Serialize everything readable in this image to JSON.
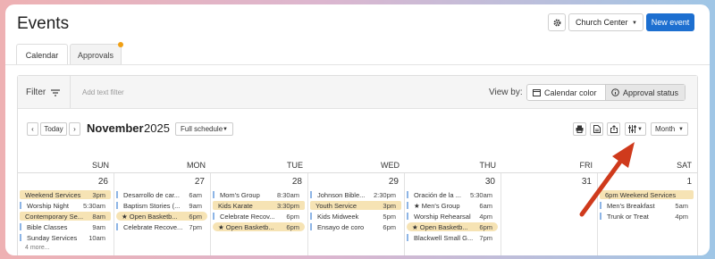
{
  "header": {
    "title": "Events",
    "org_select": "Church Center",
    "new_event_label": "New event"
  },
  "tabs": [
    {
      "label": "Calendar"
    },
    {
      "label": "Approvals"
    }
  ],
  "filter_bar": {
    "filter_label": "Filter",
    "add_filter_placeholder": "Add text filter",
    "view_by_label": "View by:",
    "options": [
      "Calendar color",
      "Approval status"
    ]
  },
  "toolbar": {
    "today_label": "Today",
    "month": "November",
    "year": "2025",
    "schedule_select": "Full schedule",
    "view_select": "Month"
  },
  "days_of_week": [
    "SUN",
    "MON",
    "TUE",
    "WED",
    "THU",
    "FRI",
    "SAT"
  ],
  "columns": [
    {
      "date": "26",
      "events": [
        {
          "name": "Weekend Services",
          "time": "3pm",
          "style": "highlight"
        },
        {
          "name": "Worship Night",
          "time": "5:30am",
          "style": "normal"
        },
        {
          "name": "Contemporary Se...",
          "time": "8am",
          "style": "highlight"
        },
        {
          "name": "Bible Classes",
          "time": "9am",
          "style": "normal"
        },
        {
          "name": "Sunday Services",
          "time": "10am",
          "style": "normal"
        }
      ],
      "more": "4 more..."
    },
    {
      "date": "27",
      "events": [
        {
          "name": "Desarrollo de car...",
          "time": "6am",
          "style": "normal"
        },
        {
          "name": "Baptism Stories (...",
          "time": "9am",
          "style": "normal"
        },
        {
          "name": "★ Open Basketb...",
          "time": "6pm",
          "style": "pill"
        },
        {
          "name": "Celebrate Recove...",
          "time": "7pm",
          "style": "normal"
        }
      ]
    },
    {
      "date": "28",
      "events": [
        {
          "name": "Mom's Group",
          "time": "8:30am",
          "style": "normal"
        },
        {
          "name": "Kids Karate",
          "time": "3:30pm",
          "style": "highlight"
        },
        {
          "name": "Celebrate Recov...",
          "time": "6pm",
          "style": "normal"
        },
        {
          "name": "★ Open Basketb...",
          "time": "6pm",
          "style": "pill"
        }
      ]
    },
    {
      "date": "29",
      "events": [
        {
          "name": "Johnson Bible...",
          "time": "2:30pm",
          "style": "normal"
        },
        {
          "name": "Youth Service",
          "time": "3pm",
          "style": "highlight"
        },
        {
          "name": "Kids Midweek",
          "time": "5pm",
          "style": "normal"
        },
        {
          "name": "Ensayo de coro",
          "time": "6pm",
          "style": "normal"
        }
      ]
    },
    {
      "date": "30",
      "events": [
        {
          "name": "Oración de la ...",
          "time": "5:30am",
          "style": "normal"
        },
        {
          "name": "★ Men's Group",
          "time": "6am",
          "style": "normal"
        },
        {
          "name": "Worship Rehearsal",
          "time": "4pm",
          "style": "normal"
        },
        {
          "name": "★ Open Basketb...",
          "time": "6pm",
          "style": "pill"
        },
        {
          "name": "Blackwell Small G...",
          "time": "7pm",
          "style": "normal"
        }
      ]
    },
    {
      "date": "31",
      "events": []
    },
    {
      "date": "1",
      "events": [
        {
          "name": "6pm Weekend Services",
          "time": "",
          "style": "fullhl"
        },
        {
          "name": "Men's Breakfast",
          "time": "5am",
          "style": "normal"
        },
        {
          "name": "Trunk or Treat",
          "time": "4pm",
          "style": "normal"
        }
      ]
    }
  ],
  "colors": {
    "primary": "#1d6fd0",
    "highlight": "#f6e3b4",
    "event_bar": "#8db5e6",
    "arrow": "#cf3a1c",
    "badge": "#f0a015"
  }
}
